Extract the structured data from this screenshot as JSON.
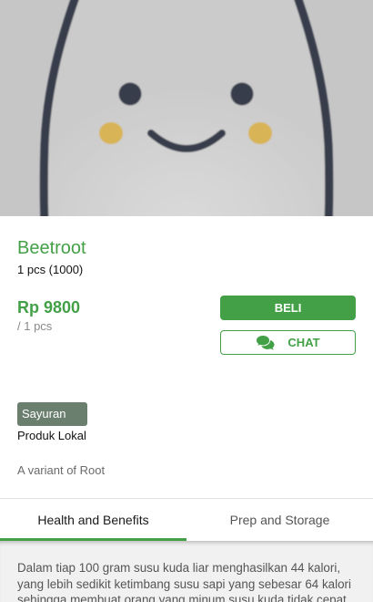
{
  "hero": {
    "image_icon": "smiling-egg-placeholder-icon"
  },
  "product": {
    "name": "Beetroot",
    "quantity": "1 pcs (1000)",
    "price": "Rp 9800",
    "per_unit": "/ 1 pcs",
    "category": "Sayuran",
    "origin": "Produk Lokal",
    "description": "A variant of Root"
  },
  "actions": {
    "buy_label": "BELI",
    "chat_label": "CHAT",
    "chat_icon": "comments-icon"
  },
  "tabs": [
    {
      "label": "Health and Benefits",
      "active": true
    },
    {
      "label": "Prep and Storage",
      "active": false
    }
  ],
  "tab_content": {
    "text": "Dalam tiap 100 gram susu kuda liar menghasilkan 44 kalori, yang lebih sedikit ketimbang susu sapi yang sebesar 64 kalori sehingga membuat orang yang minum susu kuda tidak cepat"
  },
  "colors": {
    "accent": "#43a047",
    "category_badge": "#6b7f6f",
    "hero_background": "#c6c6c6"
  }
}
